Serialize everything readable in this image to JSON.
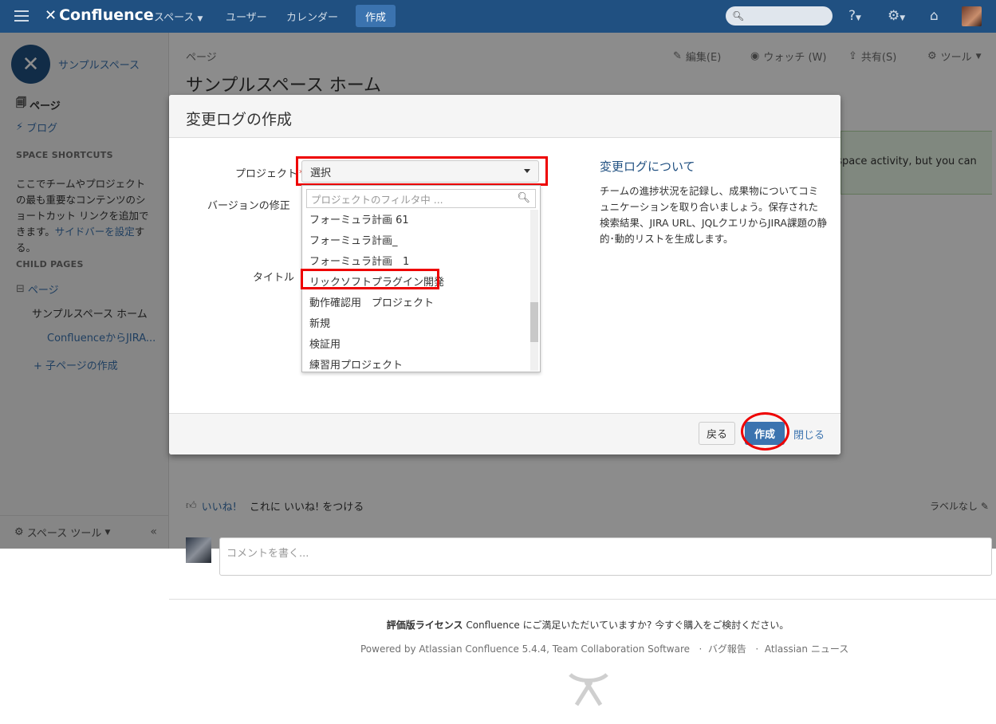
{
  "topnav": {
    "brand": "Confluence",
    "spaces": "スペース",
    "users": "ユーザー",
    "calendar": "カレンダー",
    "create": "作成"
  },
  "sidebar": {
    "space_name": "サンプルスペース",
    "pages": "ページ",
    "blog": "ブログ",
    "shortcuts_heading": "SPACE SHORTCUTS",
    "shortcuts_desc": "ここでチームやプロジェクトの最も重要なコンテンツのショートカット リンクを追加できます。",
    "shortcuts_link": "サイドバーを設定",
    "shortcuts_suffix": "する。",
    "child_heading": "CHILD PAGES",
    "tree_root": "ページ",
    "tree_home": "サンプルスペース ホーム",
    "tree_child": "ConfluenceからJIRA...",
    "add_child": "+ 子ページの作成",
    "space_tools": "スペース ツール"
  },
  "page": {
    "breadcrumb": "ページ",
    "title": "サンプルスペース ホーム",
    "edit": "編集(E)",
    "watch": "ウォッチ (W)",
    "share": "共有(S)",
    "tools": "ツール",
    "notice": "t space activity, but you can",
    "like": "いいね!",
    "like_prompt": "これに いいね! をつける",
    "labels": "ラベルなし",
    "comment_placeholder": "コメントを書く...",
    "license_bold": "評価版ライセンス",
    "license_text": " Confluence にご満足いただいていますか? 今すぐ購入をご検討ください。",
    "powered": "Powered by Atlassian Confluence 5.4.4, Team Collaboration Software",
    "bug": "バグ報告",
    "news": "Atlassian ニュース"
  },
  "dialog": {
    "title": "変更ログの作成",
    "project_label": "プロジェクト",
    "version_label": "バージョンの修正",
    "title_label": "タイトル",
    "select_value": "選択",
    "filter_placeholder": "プロジェクトのフィルタ中 ...",
    "options": [
      "フォーミュラ計画 61",
      "フォーミュラ計画_",
      "フォーミュラ計画　1",
      "リックソフトプラグイン開発",
      "動作確認用　プロジェクト",
      "新規",
      "検証用",
      "練習用プロジェクト"
    ],
    "about_title": "変更ログについて",
    "about_text": "チームの進捗状況を記録し、成果物についてコミュニケーションを取り合いましょう。保存された検索結果、JIRA URL、JQLクエリからJIRA課題の静的･動的リストを生成します。",
    "back": "戻る",
    "create": "作成",
    "close": "閉じる"
  }
}
